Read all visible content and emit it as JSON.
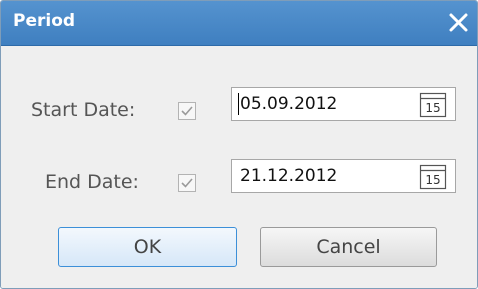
{
  "dialog": {
    "title": "Period",
    "close_icon": "close-icon"
  },
  "start": {
    "label": "Start Date:",
    "checked": true,
    "value": "05.09.2012",
    "calendar_day": "15"
  },
  "end": {
    "label": "End Date:",
    "checked": true,
    "value": "21.12.2012",
    "calendar_day": "15"
  },
  "buttons": {
    "ok": "OK",
    "cancel": "Cancel"
  }
}
